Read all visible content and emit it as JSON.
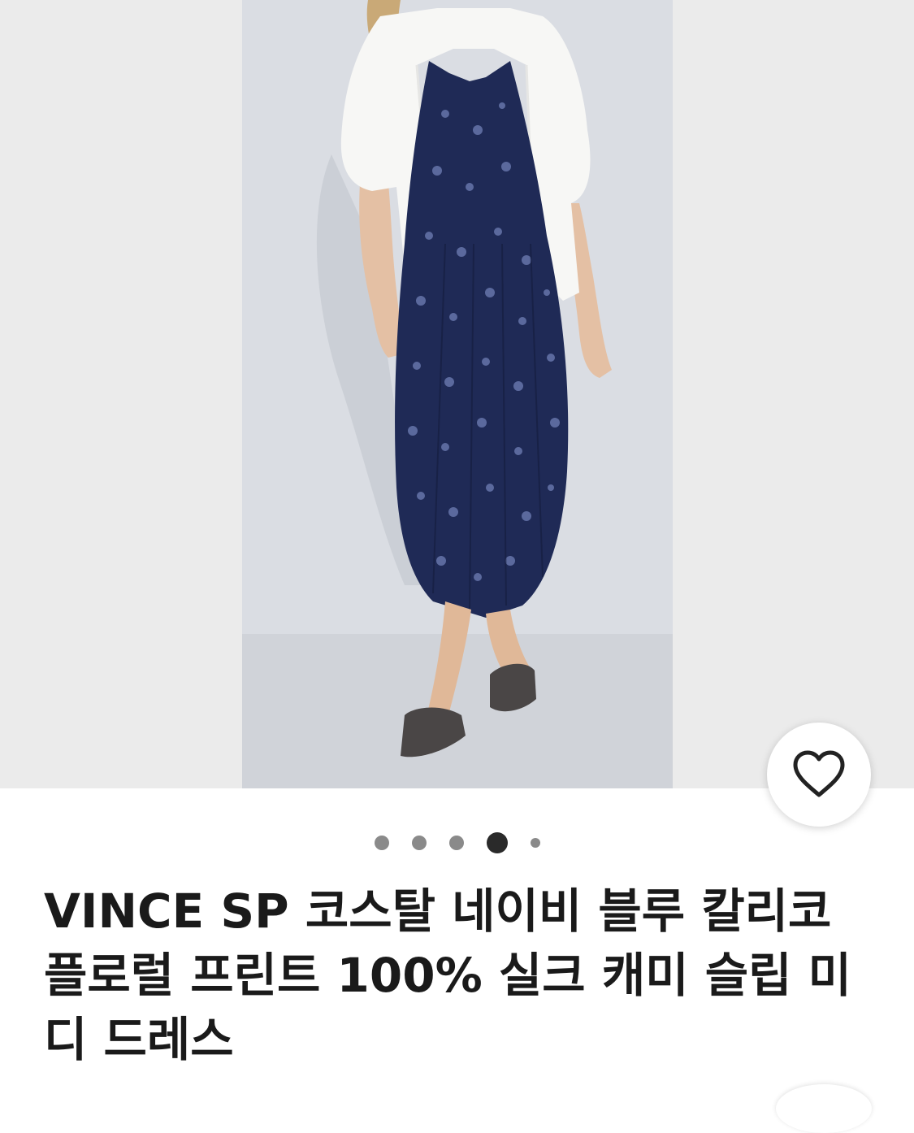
{
  "product": {
    "title": "VINCE SP 코스탈 네이비 블루 칼리코\n플로럴 프린트 100% 실크 캐미 슬립 미\n디 드레스",
    "image_alt": "product photo"
  },
  "carousel": {
    "total": 5,
    "active_index": 3
  },
  "icons": {
    "favorite": "heart-outline-icon"
  },
  "colors": {
    "text": "#1a1a1a",
    "dot_inactive": "#8a8a8a",
    "dot_active": "#2a2a2a",
    "background": "#ebebeb"
  }
}
